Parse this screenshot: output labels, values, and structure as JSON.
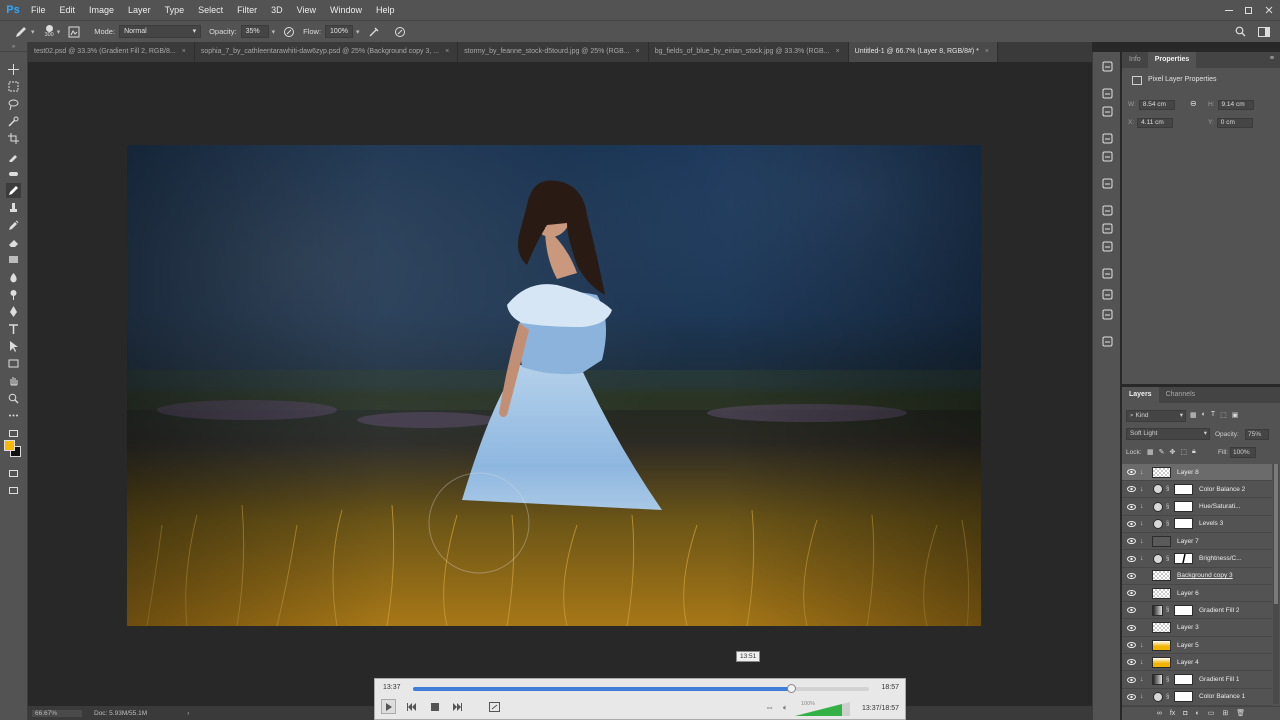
{
  "app": {
    "logo": "Ps"
  },
  "menu": [
    "File",
    "Edit",
    "Image",
    "Layer",
    "Type",
    "Select",
    "Filter",
    "3D",
    "View",
    "Window",
    "Help"
  ],
  "options": {
    "brush_size": "300",
    "mode_label": "Mode:",
    "mode_value": "Normal",
    "opacity_label": "Opacity:",
    "opacity_value": "35%",
    "flow_label": "Flow:",
    "flow_value": "100%"
  },
  "tabs": [
    {
      "label": "test02.psd @ 33.3% (Gradient Fill 2, RGB/8..."
    },
    {
      "label": "sophia_7_by_cathleentarawhiti-daw6zyp.psd @ 25% (Background copy 3, ..."
    },
    {
      "label": "stormy_by_feanne_stock-d5tourd.jpg @ 25% (RGB..."
    },
    {
      "label": "bg_fields_of_blue_by_eirian_stock.jpg @ 33.3% (RGB..."
    },
    {
      "label": "Untitled-1 @ 66.7% (Layer 8, RGB/8#) *"
    }
  ],
  "status": {
    "zoom": "66.67%",
    "doc": "Doc: 5.93M/55.1M"
  },
  "properties": {
    "tab_info": "Info",
    "tab_properties": "Properties",
    "title": "Pixel Layer Properties",
    "w_label": "W:",
    "w_value": "8.54 cm",
    "h_label": "H:",
    "h_value": "9.14 cm",
    "x_label": "X:",
    "x_value": "4.11 cm",
    "y_label": "Y:",
    "y_value": "0 cm"
  },
  "layers_panel": {
    "tab_layers": "Layers",
    "tab_channels": "Channels",
    "kind_label": "Kind",
    "blend_mode": "Soft Light",
    "opacity_label": "Opacity:",
    "opacity_value": "75%",
    "lock_label": "Lock:",
    "fill_label": "Fill:",
    "fill_value": "100%",
    "layers": [
      {
        "name": "Layer 8",
        "type": "pixel",
        "thumb": "checker",
        "clip": true,
        "selected": true
      },
      {
        "name": "Color Balance 2",
        "type": "adjust",
        "clip": true
      },
      {
        "name": "Hue/Saturati...",
        "type": "adjust",
        "clip": true
      },
      {
        "name": "Levels 3",
        "type": "adjust",
        "clip": true
      },
      {
        "name": "Layer 7",
        "type": "pixel",
        "thumb": "dark",
        "clip": true
      },
      {
        "name": "Brightness/C...",
        "type": "adjust",
        "clip": true,
        "mask": "dark-line"
      },
      {
        "name": "Background copy 3",
        "type": "pixel",
        "thumb": "checker",
        "clip": false,
        "underline": true
      },
      {
        "name": "Layer 6",
        "type": "pixel",
        "thumb": "checker",
        "clip": false
      },
      {
        "name": "Gradient Fill 2",
        "type": "gradient",
        "clip": false
      },
      {
        "name": "Layer 3",
        "type": "pixel",
        "thumb": "checker",
        "clip": false
      },
      {
        "name": "Layer 5",
        "type": "pixel",
        "thumb": "orange",
        "clip": true
      },
      {
        "name": "Layer 4",
        "type": "pixel",
        "thumb": "orange",
        "clip": true
      },
      {
        "name": "Gradient Fill 1",
        "type": "gradient",
        "clip": true
      },
      {
        "name": "Color Balance 1",
        "type": "adjust",
        "clip": true
      }
    ]
  },
  "player": {
    "start_time": "13:37",
    "end_time": "18:57",
    "tooltip_time": "13:51",
    "progress": 0.83,
    "volume_label": "100%",
    "position_readout": "13:37/18:57"
  },
  "colors": {
    "foreground": "#f6b800",
    "background": "#111111",
    "accent": "#31a8ff"
  }
}
